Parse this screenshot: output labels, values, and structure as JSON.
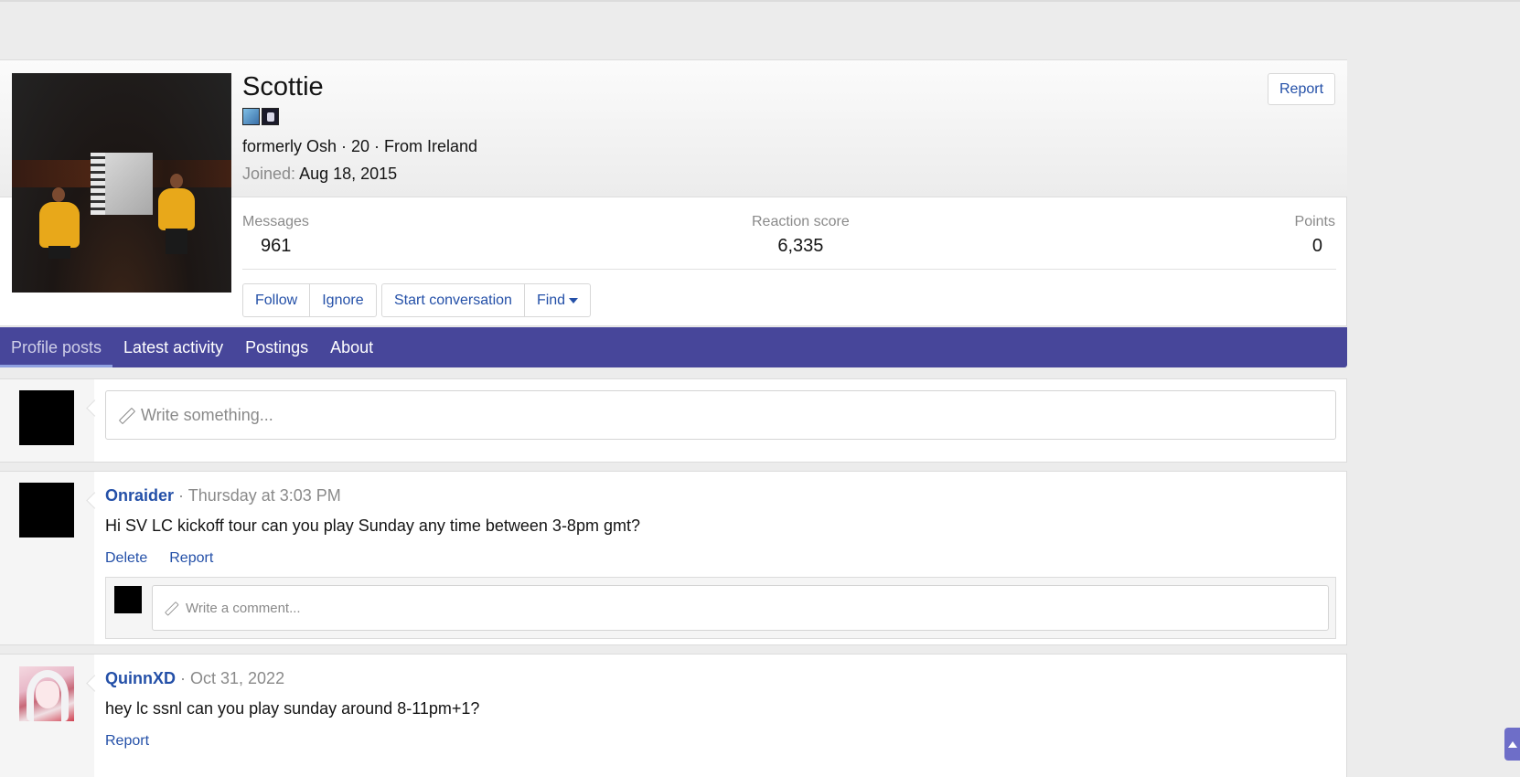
{
  "profile": {
    "name": "Scottie",
    "blurb": "formerly Osh · 20 · From Ireland",
    "joined_label": "Joined:",
    "joined_value": "Aug 18, 2015",
    "report_label": "Report",
    "badges": [
      "badge-icon",
      "badge-icon"
    ]
  },
  "stats": {
    "messages_label": "Messages",
    "messages_value": "961",
    "reaction_label": "Reaction score",
    "reaction_value": "6,335",
    "points_label": "Points",
    "points_value": "0"
  },
  "buttons": {
    "follow": "Follow",
    "ignore": "Ignore",
    "start_conversation": "Start conversation",
    "find": "Find"
  },
  "tabs": [
    {
      "label": "Profile posts",
      "active": true
    },
    {
      "label": "Latest activity",
      "active": false
    },
    {
      "label": "Postings",
      "active": false
    },
    {
      "label": "About",
      "active": false
    }
  ],
  "composer": {
    "placeholder": "Write something..."
  },
  "posts": [
    {
      "user": "Onraider",
      "time": "· Thursday at 3:03 PM",
      "text": "Hi SV LC kickoff tour can you play Sunday any time between 3-8pm gmt?",
      "actions": [
        "Delete",
        "Report"
      ],
      "comment_placeholder": "Write a comment..."
    },
    {
      "user": "QuinnXD",
      "time": "· Oct 31, 2022",
      "text": "hey lc ssnl can you play sunday around 8-11pm+1?",
      "actions": [
        "Report"
      ]
    }
  ],
  "colors": {
    "accent": "#47469a",
    "link": "#2450a8",
    "muted": "#8a8a8a"
  }
}
